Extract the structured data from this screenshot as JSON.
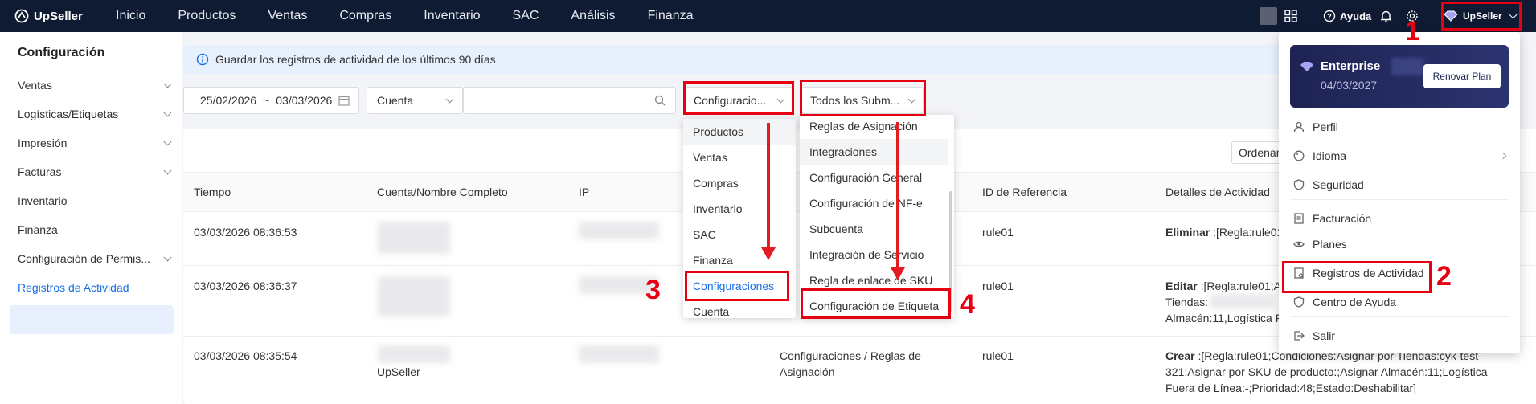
{
  "app": {
    "logo": "UpSeller"
  },
  "nav": [
    "Inicio",
    "Productos",
    "Ventas",
    "Compras",
    "Inventario",
    "SAC",
    "Análisis",
    "Finanza"
  ],
  "topright": {
    "help": "Ayuda",
    "account": "UpSeller"
  },
  "sidebar": {
    "title": "Configuración",
    "items": [
      {
        "label": "Ventas",
        "chevron": true
      },
      {
        "label": "Logísticas/Etiquetas",
        "chevron": true
      },
      {
        "label": "Impresión",
        "chevron": true
      },
      {
        "label": "Facturas",
        "chevron": true
      },
      {
        "label": "Inventario",
        "chevron": false
      },
      {
        "label": "Finanza",
        "chevron": false
      },
      {
        "label": "Configuración de Permis...",
        "chevron": true
      },
      {
        "label": "Registros de Actividad",
        "chevron": false,
        "active": true
      }
    ]
  },
  "notice": "Guardar los registros de actividad de los últimos 90 días",
  "filters": {
    "date_from": "25/02/2026",
    "date_sep": "~",
    "date_to": "03/03/2026",
    "account_select": "Cuenta",
    "module_select": "Configuracio...",
    "submodule_select": "Todos los Subm..."
  },
  "order_button": "Ordenar",
  "table": {
    "headers": [
      "Tiempo",
      "Cuenta/Nombre Completo",
      "IP",
      "ID de Referencia",
      "Detalles de Actividad"
    ],
    "rows": [
      {
        "time": "03/03/2026 08:36:53",
        "ref": "rule01",
        "detail_action": "Eliminar",
        "detail_text": ":[Regla:rule01"
      },
      {
        "time": "03/03/2026 08:36:37",
        "ref": "rule01",
        "detail_action": "Editar",
        "detail_text": ":[Regla:rule01;A",
        "detail_l2": "Tiendas:",
        "detail_l3": "Almacén:11,Logística F"
      },
      {
        "time": "03/03/2026 08:35:54",
        "account_tail": "UpSeller",
        "module": "Configuraciones / Reglas de",
        "module_l2": "Asignación",
        "ref": "rule01",
        "detail_action": "Crear",
        "detail_text": ":[Regla:rule01;Condiciones:Asignar por Tiendas:cyk-test-",
        "detail_l2": "321;Asignar por SKU de producto:;Asignar Almacén:11;Logística",
        "detail_l3": "Fuera de Línea:-;Prioridad:48;Estado:Deshabilitar]"
      }
    ]
  },
  "module_dropdown": [
    "Productos",
    "Ventas",
    "Compras",
    "Inventario",
    "SAC",
    "Finanza",
    "Configuraciones",
    "Cuenta"
  ],
  "submodule_dropdown": [
    "Reglas de Asignación",
    "Integraciones",
    "Configuración General",
    "Configuración de NF-e",
    "Subcuenta",
    "Integración de Servicio",
    "Regla de enlace de SKU",
    "Configuración de Etiqueta"
  ],
  "account_menu": {
    "plan": "Enterprise",
    "plan_date": "04/03/2027",
    "renew": "Renovar Plan",
    "items": [
      "Perfil",
      "Idioma",
      "Seguridad",
      "Facturación",
      "Planes",
      "Registros de Actividad",
      "Centro de Ayuda",
      "Salir"
    ]
  },
  "annotations": [
    "1",
    "2",
    "3",
    "4"
  ],
  "colors": {
    "topbar": "#0f1b33",
    "accent": "#1a6fe8",
    "annotation": "#e60012"
  }
}
